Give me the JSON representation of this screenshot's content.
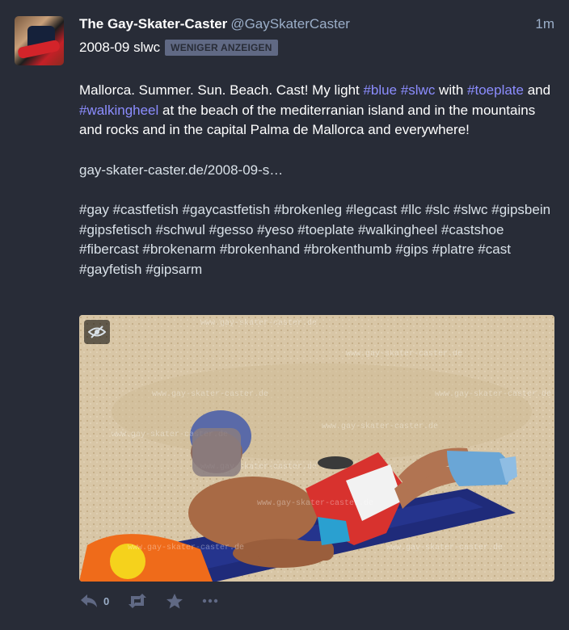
{
  "author": {
    "display_name": "The Gay-Skater-Caster",
    "handle": "@GaySkaterCaster",
    "time": "1m"
  },
  "content_warning": {
    "text": "2008-09 slwc",
    "button_label": "WENIGER ANZEIGEN"
  },
  "body": {
    "p1_a": "Mallorca. Summer. Sun. Beach. Cast! My light ",
    "tag_blue": "#blue",
    "tag_slwc": "#slwc",
    "p1_b": " with",
    "tag_toeplate": "#toeplate",
    "p1_c": " and ",
    "tag_walkingheel": "#walkingheel",
    "p1_d": " at the beach of the mediterranian island and in the mountains and rocks and in the capital Palma de Mallorca and everywhere!",
    "link": "gay-skater-caster.de/2008-09-s…",
    "hashtags": "#gay #castfetish #gaycastfetish #brokenleg #legcast #llc #slc #slwc #gipsbein #gipsfetisch #schwul #gesso #yeso #toeplate #walkingheel #castshoe #fibercast #brokenarm #brokenhand #brokenthumb #gips #platre #cast #gayfetish #gipsarm"
  },
  "media": {
    "watermark": "www.gay-skater-caster.de",
    "hide_icon": "eye-slash-icon"
  },
  "actions": {
    "reply_icon": "reply-icon",
    "reply_count": "0",
    "boost_icon": "retweet-icon",
    "favourite_icon": "star-icon",
    "more_icon": "ellipsis-icon"
  },
  "colors": {
    "background": "#282c37",
    "secondary_text": "#9baec8",
    "hashtag": "#8c8dff",
    "button": "#606984"
  }
}
